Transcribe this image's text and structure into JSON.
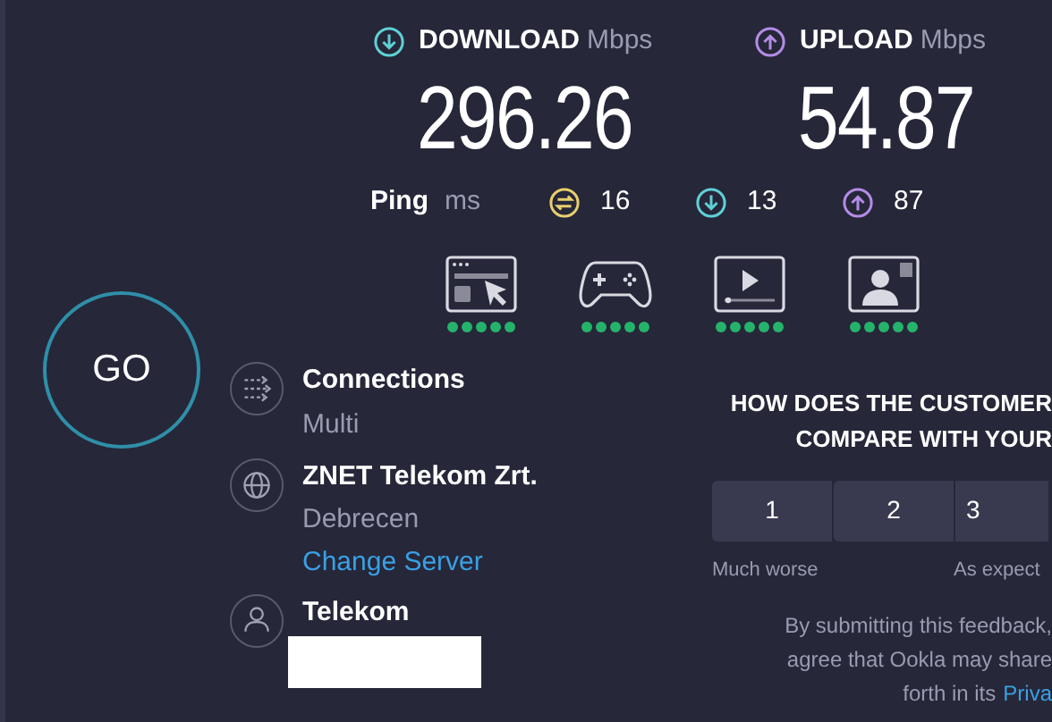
{
  "go_button": "GO",
  "download": {
    "label": "DOWNLOAD",
    "unit": "Mbps",
    "value": "296.26"
  },
  "upload": {
    "label": "UPLOAD",
    "unit": "Mbps",
    "value": "54.87"
  },
  "ping": {
    "label": "Ping",
    "unit": "ms",
    "readings": [
      {
        "kind": "idle",
        "value": "16"
      },
      {
        "kind": "download",
        "value": "13"
      },
      {
        "kind": "upload",
        "value": "87"
      }
    ]
  },
  "activities": [
    {
      "kind": "browsing",
      "stars": 5
    },
    {
      "kind": "gaming",
      "stars": 5
    },
    {
      "kind": "streaming",
      "stars": 5
    },
    {
      "kind": "video_call",
      "stars": 5
    }
  ],
  "connections": {
    "label": "Connections",
    "value": "Multi"
  },
  "server": {
    "name": "ZNET Telekom Zrt.",
    "location": "Debrecen",
    "link": "Change Server"
  },
  "provider": {
    "name": "Telekom",
    "redacted": true
  },
  "feedback": {
    "title_lines": [
      "HOW DOES THE CUSTOMER",
      "COMPARE WITH YOUR"
    ],
    "scale": [
      {
        "label": "1"
      },
      {
        "label": "2"
      },
      {
        "label": "3"
      }
    ],
    "scale_labels": [
      "Much worse",
      "As expect"
    ],
    "disclaimer_lines": [
      "By submitting this feedback,",
      "agree that Ookla may share",
      "forth in its"
    ],
    "link": "Priva"
  }
}
